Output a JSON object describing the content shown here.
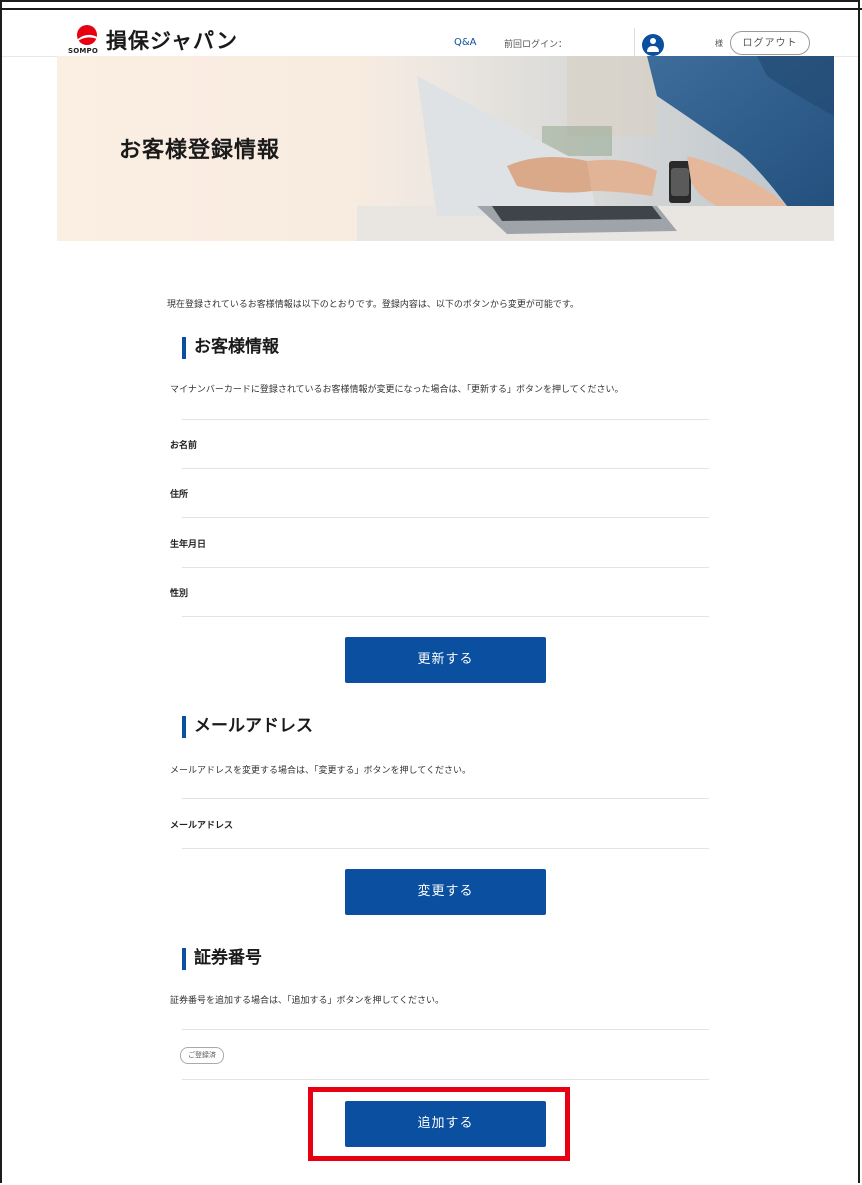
{
  "header": {
    "brand_sub": "SOMPO",
    "brand_name": "損保ジャパン",
    "nav_qa": "Q&A",
    "last_login_label": "前回ログイン：",
    "honorific": "様",
    "logout_label": "ログアウト",
    "accent_color": "#0a4fa0",
    "logo_color": "#e60012"
  },
  "hero": {
    "title": "お客様登録情報"
  },
  "intro": "現在登録されているお客様情報は以下のとおりです。登録内容は、以下のボタンから変更が可能です。",
  "customer_section": {
    "title": "お客様情報",
    "description": "マイナンバーカードに登録されているお客様情報が変更になった場合は、「更新する」ボタンを押してください。",
    "fields": [
      "お名前",
      "住所",
      "生年月日",
      "性別"
    ],
    "button_label": "更新する"
  },
  "email_section": {
    "title": "メールアドレス",
    "description": "メールアドレスを変更する場合は、「変更する」ボタンを押してください。",
    "field": "メールアドレス",
    "button_label": "変更する"
  },
  "policy_section": {
    "title": "証券番号",
    "description": "証券番号を追加する場合は、「追加する」ボタンを押してください。",
    "tag": "ご登録済",
    "button_label": "追加する"
  },
  "highlight_color": "#e60012"
}
